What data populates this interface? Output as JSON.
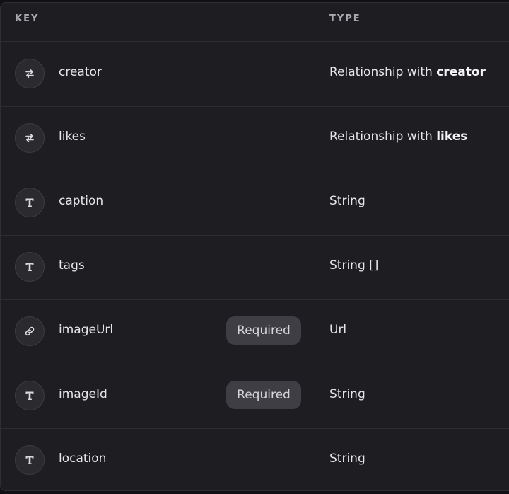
{
  "header": {
    "key_label": "KEY",
    "type_label": "TYPE"
  },
  "rows": [
    {
      "key": "creator",
      "icon": "relationship-icon",
      "required": "",
      "type_prefix": "Relationship with ",
      "type_bold": "creator"
    },
    {
      "key": "likes",
      "icon": "relationship-icon",
      "required": "",
      "type_prefix": "Relationship with ",
      "type_bold": "likes"
    },
    {
      "key": "caption",
      "icon": "text-type-icon",
      "required": "",
      "type_prefix": "String",
      "type_bold": ""
    },
    {
      "key": "tags",
      "icon": "text-type-icon",
      "required": "",
      "type_prefix": "String []",
      "type_bold": ""
    },
    {
      "key": "imageUrl",
      "icon": "link-icon",
      "required": "Required",
      "type_prefix": "Url",
      "type_bold": ""
    },
    {
      "key": "imageId",
      "icon": "text-type-icon",
      "required": "Required",
      "type_prefix": "String",
      "type_bold": ""
    },
    {
      "key": "location",
      "icon": "text-type-icon",
      "required": "",
      "type_prefix": "String",
      "type_bold": ""
    }
  ],
  "colors": {
    "panel_bg": "#1e1e22",
    "badge_bg": "#3e3e44",
    "text": "#e6e6ea",
    "header_text": "#a9a9b0"
  }
}
